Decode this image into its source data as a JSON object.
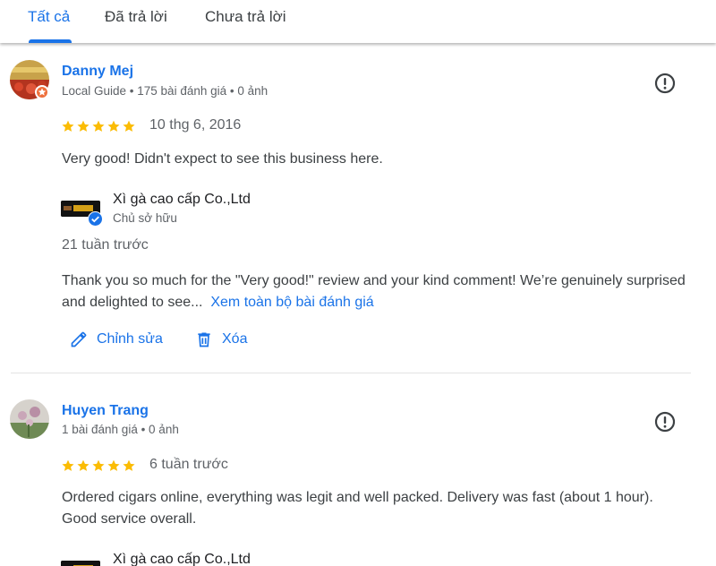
{
  "tabs": [
    {
      "label": "Tất cả",
      "active": true
    },
    {
      "label": "Đã trả lời",
      "active": false
    },
    {
      "label": "Chưa trả lời",
      "active": false
    }
  ],
  "colors": {
    "accent": "#1a73e8",
    "star": "#fbbc04",
    "local_guide_badge": "#ee6f3b"
  },
  "reviews": [
    {
      "author": "Danny Mej",
      "meta": "Local Guide • 175 bài đánh giá • 0 ảnh",
      "rating": 5,
      "date": "10 thg 6, 2016",
      "text": "Very good! Didn't expect to see this business here.",
      "report_icon": "flag-report-icon",
      "reply": {
        "owner_name": "Xì gà cao cấp Co.,Ltd",
        "owner_role": "Chủ sở hữu",
        "time": "21 tuần trước",
        "text": "Thank you so much for the \"Very good!\" review and your kind comment! We’re genuinely surprised and delighted to see...",
        "more_link": "Xem toàn bộ bài đánh giá"
      },
      "actions": [
        {
          "label": "Chỉnh sửa",
          "icon": "pencil-icon"
        },
        {
          "label": "Xóa",
          "icon": "trash-icon"
        }
      ]
    },
    {
      "author": "Huyen Trang",
      "meta": "1 bài đánh giá • 0 ảnh",
      "rating": 5,
      "date": "6 tuần trước",
      "text": "Ordered cigars online, everything was legit and well packed. Delivery was fast (about 1 hour). Good service overall.",
      "report_icon": "flag-report-icon",
      "reply": {
        "owner_name": "Xì gà cao cấp Co.,Ltd"
      }
    }
  ]
}
